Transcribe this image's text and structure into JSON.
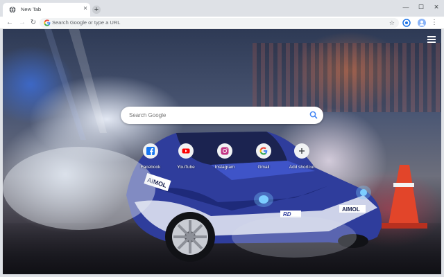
{
  "tab": {
    "title": "New Tab",
    "favicon": "globe-icon",
    "close_glyph": "×"
  },
  "new_tab_glyph": "+",
  "window_controls": {
    "minimize": "—",
    "maximize": "☐",
    "close": "✕"
  },
  "toolbar": {
    "back_glyph": "←",
    "forward_glyph": "→",
    "reload_glyph": "↻",
    "omnibox_placeholder": "Search Google or type a URL",
    "star_glyph": "☆",
    "menu_glyph": "⋮"
  },
  "search": {
    "placeholder": "Search Google"
  },
  "shortcuts": [
    {
      "label": "Facebook",
      "icon": "facebook-icon",
      "color": "#1877f2"
    },
    {
      "label": "YouTube",
      "icon": "youtube-icon",
      "color": "#ff0000"
    },
    {
      "label": "Instagram",
      "icon": "instagram-icon",
      "color": "#c13584"
    },
    {
      "label": "Gmail",
      "icon": "google-icon",
      "color": "#4285f4"
    },
    {
      "label": "Add shortcut",
      "icon": "plus-icon",
      "color": "#3c4043"
    }
  ],
  "car_sponsor_labels": {
    "door": "AIMOL",
    "bumper": "AIMOL",
    "plate": "RD"
  }
}
